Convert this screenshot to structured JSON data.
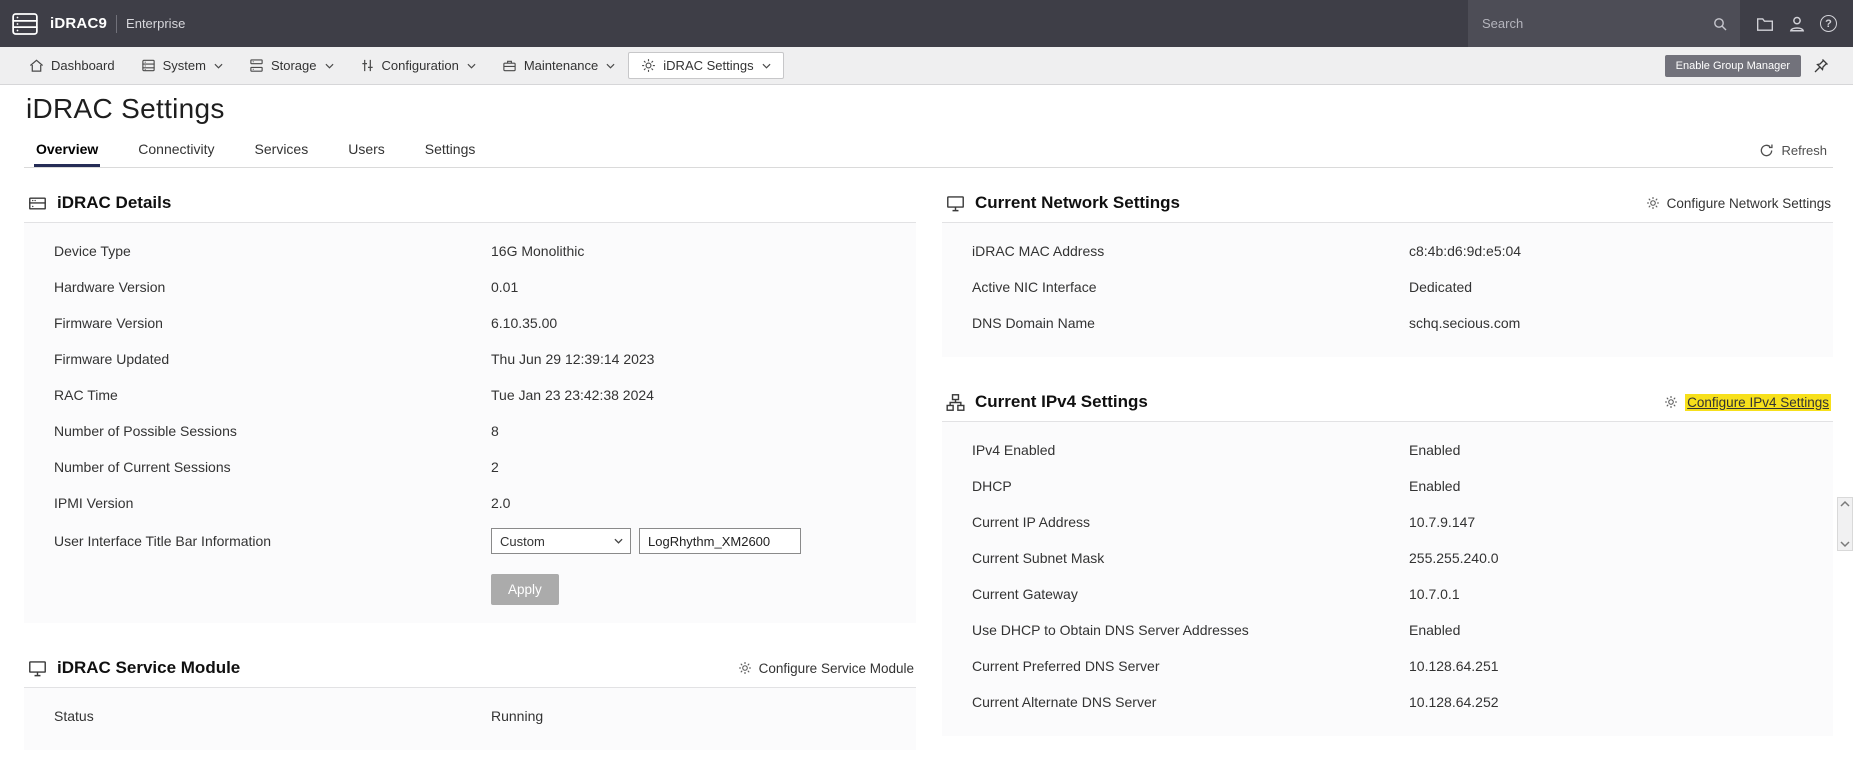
{
  "colors": {
    "header_bg": "#3e3e47",
    "nav_bg": "#efeff0",
    "active_tab_underline": "#252c56",
    "group_manager_btn": "#72727b",
    "find_highlight": "#f7e01b",
    "panel_body_bg": "#fbfbfc"
  },
  "icons": {
    "logo": "idrac-server-logo",
    "search": "magnifier",
    "files": "folder",
    "user": "person-silhouette",
    "help": "question-mark-circle",
    "dashboard": "house",
    "system": "server",
    "storage": "drive-stack",
    "configuration": "sliders",
    "maintenance": "toolbox",
    "idrac_settings": "gear",
    "chevron_down": "chevron-down",
    "pin": "push-pin",
    "refresh": "circular-arrow",
    "details_panel": "server-bays",
    "network_panel": "monitor",
    "ipv4_panel": "network-tree",
    "service_module_panel": "monitor"
  },
  "header": {
    "brand": "iDRAC9",
    "edition": "Enterprise",
    "search_placeholder": "Search",
    "help_glyph": "?"
  },
  "nav": {
    "items": [
      {
        "label": "Dashboard"
      },
      {
        "label": "System"
      },
      {
        "label": "Storage"
      },
      {
        "label": "Configuration"
      },
      {
        "label": "Maintenance"
      },
      {
        "label": "iDRAC Settings"
      }
    ],
    "group_manager_label": "Enable Group Manager"
  },
  "page": {
    "title": "iDRAC Settings",
    "tabs": [
      "Overview",
      "Connectivity",
      "Services",
      "Users",
      "Settings"
    ],
    "refresh_label": "Refresh"
  },
  "idrac_details": {
    "title": "iDRAC Details",
    "rows": [
      {
        "label": "Device Type",
        "value": "16G Monolithic"
      },
      {
        "label": "Hardware Version",
        "value": "0.01"
      },
      {
        "label": "Firmware Version",
        "value": "6.10.35.00"
      },
      {
        "label": "Firmware Updated",
        "value": "Thu Jun 29 12:39:14 2023"
      },
      {
        "label": "RAC Time",
        "value": "Tue Jan 23 23:42:38 2024"
      },
      {
        "label": "Number of Possible Sessions",
        "value": "8"
      },
      {
        "label": "Number of Current Sessions",
        "value": "2"
      },
      {
        "label": "IPMI Version",
        "value": "2.0"
      }
    ],
    "title_bar_label": "User Interface Title Bar Information",
    "title_bar_select_value": "Custom",
    "title_bar_input_value": "LogRhythm_XM2600",
    "apply_label": "Apply"
  },
  "service_module": {
    "title": "iDRAC Service Module",
    "configure_label": "Configure Service Module",
    "rows": [
      {
        "label": "Status",
        "value": "Running"
      }
    ]
  },
  "network_settings": {
    "title": "Current Network Settings",
    "configure_label": "Configure Network Settings",
    "rows": [
      {
        "label": "iDRAC MAC Address",
        "value": "c8:4b:d6:9d:e5:04"
      },
      {
        "label": "Active NIC Interface",
        "value": "Dedicated"
      },
      {
        "label": "DNS Domain Name",
        "value": "schq.secious.com"
      }
    ]
  },
  "ipv4_settings": {
    "title": "Current IPv4 Settings",
    "configure_label": "Configure IPv4 Settings",
    "rows": [
      {
        "label": "IPv4 Enabled",
        "value": "Enabled"
      },
      {
        "label": "DHCP",
        "value": "Enabled"
      },
      {
        "label": "Current IP Address",
        "value": "10.7.9.147"
      },
      {
        "label": "Current Subnet Mask",
        "value": "255.255.240.0"
      },
      {
        "label": "Current Gateway",
        "value": "10.7.0.1"
      },
      {
        "label": "Use DHCP to Obtain DNS Server Addresses",
        "value": "Enabled"
      },
      {
        "label": "Current Preferred DNS Server",
        "value": "10.128.64.251"
      },
      {
        "label": "Current Alternate DNS Server",
        "value": "10.128.64.252"
      }
    ]
  }
}
